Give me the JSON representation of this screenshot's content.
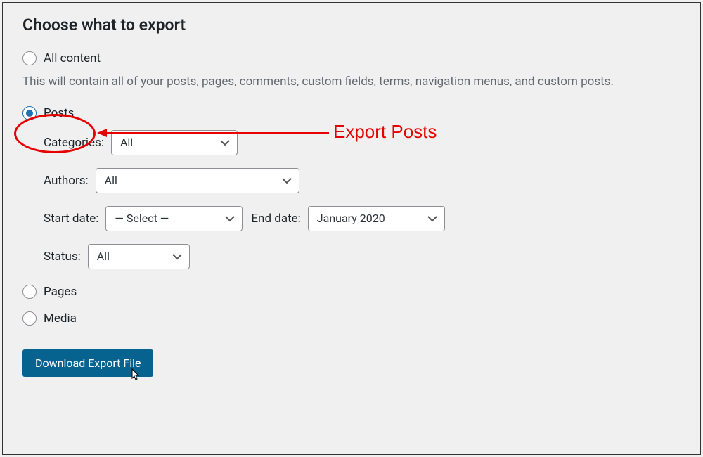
{
  "heading": "Choose what to export",
  "options": {
    "all_content": {
      "label": "All content",
      "desc": "This will contain all of your posts, pages, comments, custom fields, terms, navigation menus, and custom posts."
    },
    "posts": {
      "label": "Posts"
    },
    "pages": {
      "label": "Pages"
    },
    "media": {
      "label": "Media"
    }
  },
  "filters": {
    "categories": {
      "label": "Categories:",
      "value": "All"
    },
    "authors": {
      "label": "Authors:",
      "value": "All"
    },
    "start_date": {
      "label": "Start date:",
      "value": "— Select —"
    },
    "end_date": {
      "label": "End date:",
      "value": "January 2020"
    },
    "status": {
      "label": "Status:",
      "value": "All"
    }
  },
  "button": "Download Export File",
  "annotation": "Export Posts"
}
